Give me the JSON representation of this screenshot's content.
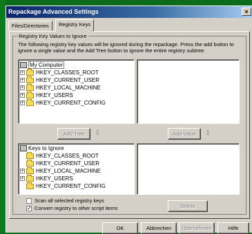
{
  "window": {
    "title": "Repackage Advanced Settings",
    "close_glyph": "×"
  },
  "tabs": [
    {
      "label": "Files/Directories"
    },
    {
      "label": "Registry Keys"
    }
  ],
  "group": {
    "title": "Registry Key Values to Ignore",
    "description": "The following registry key values will be ignored during the repackage. Press the add button to ignore a single value and the Add Tree button to ignore the entire registry subtree."
  },
  "top_tree": {
    "root": "My Computer",
    "items": [
      "HKEY_CLASSES_ROOT",
      "HKEY_CURRENT_USER",
      "HKEY_LOCAL_MACHINE",
      "HKEY_USERS",
      "HKEY_CURRENT_CONFIG"
    ]
  },
  "bottom_tree": {
    "root": "Keys to Ignore",
    "items": [
      "HKEY_CLASSES_ROOT",
      "HKEY_CURRENT_USER",
      "HKEY_LOCAL_MACHINE",
      "HKEY_USERS",
      "HKEY_CURRENT_CONFIG"
    ]
  },
  "buttons": {
    "add_tree": "Add Tree",
    "add_value": "Add Value",
    "delete": "Delete",
    "ok": "OK",
    "cancel": "Abbrechen",
    "apply": "Übernehmen",
    "help": "Hilfe"
  },
  "checkboxes": {
    "scan_all": {
      "label": "Scan all selected registry keys",
      "checked": false
    },
    "convert": {
      "label": "Convert registry to other script items",
      "checked": true
    }
  },
  "glyphs": {
    "expand": "+",
    "down_arrow": "⇩",
    "check": "✓"
  }
}
